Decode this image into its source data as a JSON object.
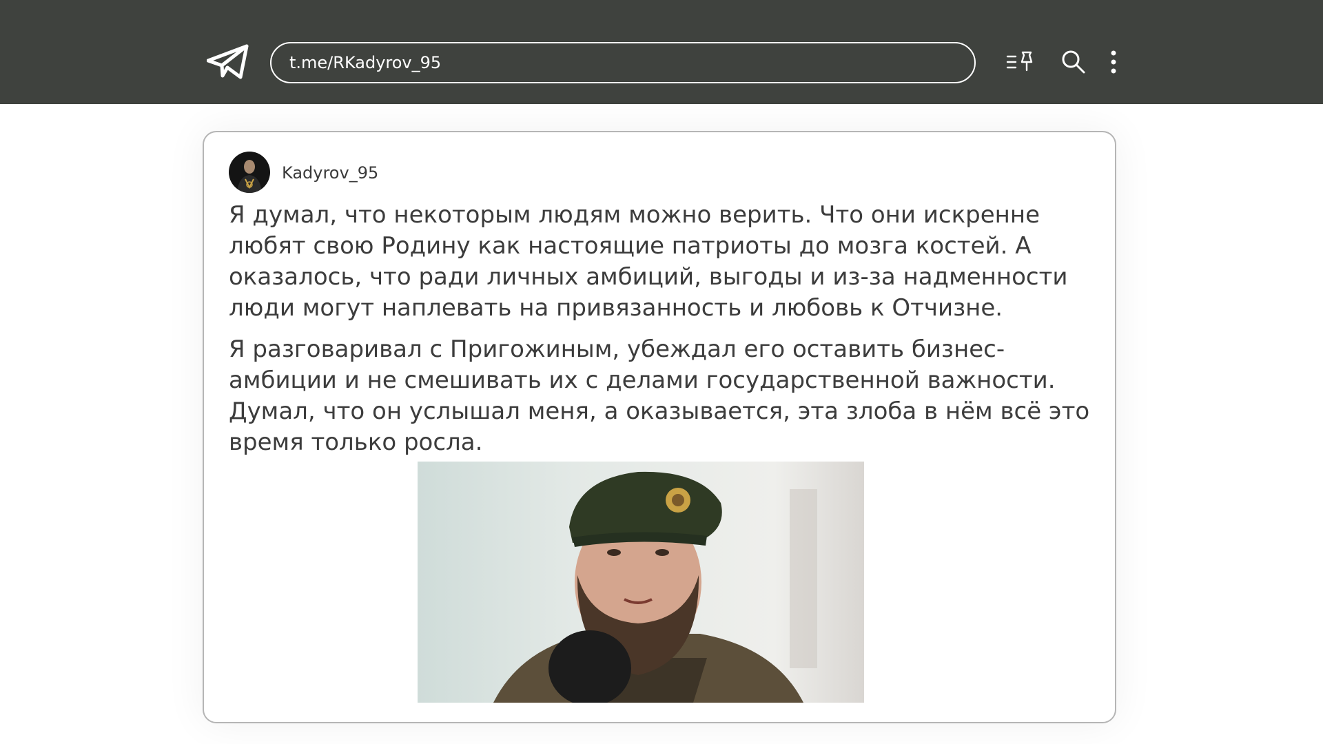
{
  "header": {
    "url": "t.me/RKadyrov_95",
    "icons": [
      "telegram-logo-icon",
      "pinned-list-icon",
      "search-icon",
      "more-vertical-icon"
    ]
  },
  "post": {
    "channel_name": "Kadyrov_95",
    "paragraphs": [
      "Я думал, что некоторым людям можно верить. Что они искренне любят свою Родину как настоящие патриоты до мозга костей. А оказалось, что ради личных амбиций, выгоды и из-за надменности люди могут наплевать на привязанность и любовь к Отчизне.",
      "Я разговаривал с Пригожиным, убеждал его оставить бизнес-амбиции и не смешивать их с делами государственной важности. Думал, что он услышал меня, а оказывается, эта злоба в нём всё это время только росла."
    ]
  },
  "colors": {
    "header_bg": "#3f423e",
    "text": "#3c3c3c",
    "card_border": "#b5b5b5"
  }
}
